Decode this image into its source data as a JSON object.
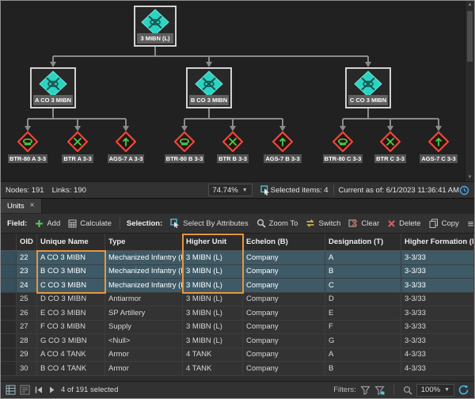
{
  "chart": {
    "root_label": "3 MIBN (L)",
    "companies": [
      {
        "label": "A CO 3 MIBN",
        "children": [
          "BTR-80 A 3-3",
          "BTR A 3-3",
          "AGS-7 A 3-3"
        ]
      },
      {
        "label": "B CO 3 MIBN",
        "children": [
          "BTR-80 B 3-3",
          "BTR B 3-3",
          "AGS-7 B 3-3"
        ]
      },
      {
        "label": "C CO 3 MIBN",
        "children": [
          "BTR-80 C 3-3",
          "BTR C 3-3",
          "AGS-7 C 3-3"
        ]
      }
    ],
    "status": {
      "nodes": "Nodes: 191",
      "links": "Links: 190",
      "zoom": "74.74%",
      "selected_items": "Selected items: 4",
      "current_as_of": "Current as of: 6/1/2023 11:36:41 AM"
    }
  },
  "panel": {
    "tab_label": "Units",
    "toolbar": {
      "field_label": "Field:",
      "add": "Add",
      "calculate": "Calculate",
      "selection_label": "Selection:",
      "select_by_attributes": "Select By Attributes",
      "zoom_to": "Zoom To",
      "switch": "Switch",
      "clear": "Clear",
      "delete": "Delete",
      "copy": "Copy"
    },
    "table": {
      "headers": {
        "oid": "OID",
        "unique_name": "Unique Name",
        "type": "Type",
        "higher_unit": "Higher Unit",
        "echelon": "Echelon (B)",
        "designation": "Designation (T)",
        "higher_formation": "Higher Formation (M)"
      },
      "selected_oids": [
        "22",
        "23",
        "24"
      ],
      "rows": [
        {
          "oid": "22",
          "unique_name": "A CO 3 MIBN",
          "type": "Mechanized Infantry (Li...",
          "higher_unit": "3 MIBN (L)",
          "echelon": "Company",
          "designation": "A",
          "higher_formation": "3-3/33"
        },
        {
          "oid": "23",
          "unique_name": "B CO 3 MIBN",
          "type": "Mechanized Infantry (Li...",
          "higher_unit": "3 MIBN (L)",
          "echelon": "Company",
          "designation": "B",
          "higher_formation": "3-3/33"
        },
        {
          "oid": "24",
          "unique_name": "C CO 3 MIBN",
          "type": "Mechanized Infantry (Li...",
          "higher_unit": "3 MIBN (L)",
          "echelon": "Company",
          "designation": "C",
          "higher_formation": "3-3/33"
        },
        {
          "oid": "25",
          "unique_name": "D CO 3 MIBN",
          "type": "Antiarmor",
          "higher_unit": "3 MIBN (L)",
          "echelon": "Company",
          "designation": "D",
          "higher_formation": "3-3/33"
        },
        {
          "oid": "26",
          "unique_name": "E CO 3 MIBN",
          "type": "SP Artillery",
          "higher_unit": "3 MIBN (L)",
          "echelon": "Company",
          "designation": "E",
          "higher_formation": "3-3/33"
        },
        {
          "oid": "27",
          "unique_name": "F CO 3 MIBN",
          "type": "Supply",
          "higher_unit": "3 MIBN (L)",
          "echelon": "Company",
          "designation": "F",
          "higher_formation": "3-3/33"
        },
        {
          "oid": "28",
          "unique_name": "G CO 3 MIBN",
          "type": "<Null>",
          "higher_unit": "3 MIBN (L)",
          "echelon": "Company",
          "designation": "G",
          "higher_formation": "3-3/33"
        },
        {
          "oid": "29",
          "unique_name": "A CO 4 TANK",
          "type": "Armor",
          "higher_unit": "4 TANK",
          "echelon": "Company",
          "designation": "A",
          "higher_formation": "4-3/33"
        },
        {
          "oid": "30",
          "unique_name": "B CO 4 TANK",
          "type": "Armor",
          "higher_unit": "4 TANK",
          "echelon": "Company",
          "designation": "B",
          "higher_formation": "4-3/33"
        }
      ]
    },
    "footer": {
      "record_status": "4 of 191 selected",
      "filters_label": "Filters:",
      "zoom": "100%"
    }
  },
  "colors": {
    "highlight_orange": "#E8953C",
    "friendly_symbol_teal": "#2BD3C2",
    "hostile_symbol_red": "#F0473A",
    "hostile_glyph_green": "#3FD24A",
    "selected_row": "#3E5A67"
  }
}
